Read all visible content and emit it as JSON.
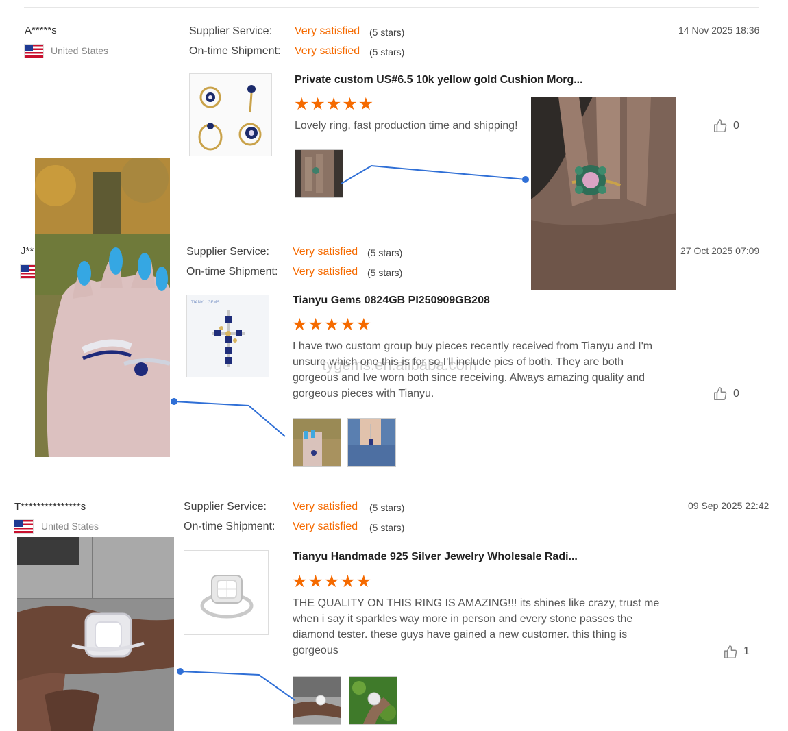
{
  "reviews": [
    {
      "user": "A*****s",
      "country": "United States",
      "supplier_label": "Supplier Service:",
      "supplier_value": "Very satisfied",
      "supplier_stars": "(5 stars)",
      "shipment_label": "On-time Shipment:",
      "shipment_value": "Very satisfied",
      "shipment_stars": "(5 stars)",
      "date": "14 Nov 2025 18:36",
      "product_title": "Private custom US#6.5 10k yellow gold Cushion Morg...",
      "rating": "★★★★★",
      "comment": "Lovely ring, fast production time and shipping!",
      "likes": "0"
    },
    {
      "user": "J**",
      "country": "",
      "supplier_label": "Supplier Service:",
      "supplier_value": "Very satisfied",
      "supplier_stars": "(5 stars)",
      "shipment_label": "On-time Shipment:",
      "shipment_value": "Very satisfied",
      "shipment_stars": "(5 stars)",
      "date": "27 Oct 2025 07:09",
      "product_title": "Tianyu Gems 0824GB PI250909GB208",
      "rating": "★★★★★",
      "comment": "I have two custom group buy pieces recently received from Tianyu and I'm unsure which one this is for so I'll include pics of both. They are both gorgeous and Ive worn both since receiving.  Always amazing quality and gorgeous pieces with Tianyu.",
      "likes": "0"
    },
    {
      "user": "T***************s",
      "country": "United States",
      "supplier_label": "Supplier Service:",
      "supplier_value": "Very satisfied",
      "supplier_stars": "(5 stars)",
      "shipment_label": "On-time Shipment:",
      "shipment_value": "Very satisfied",
      "shipment_stars": "(5 stars)",
      "date": "09 Sep 2025 22:42",
      "product_title": "Tianyu Handmade 925 Silver Jewelry Wholesale Radi...",
      "rating": "★★★★★",
      "comment": "THE QUALITY ON THIS RING IS AMAZING!!! its shines like crazy, trust me when i say it sparkles way more in person and every stone passes  the diamond tester. these guys have gained a new customer. this thing is gorgeous",
      "likes": "1"
    }
  ],
  "watermark": "tygems.en.alibaba.com",
  "colors": {
    "accent": "#f56a00",
    "connector": "#2f6fd6",
    "divider": "#e6e6e6"
  },
  "icons": {
    "like": "thumbs-up-icon",
    "flag": "us-flag-icon"
  }
}
